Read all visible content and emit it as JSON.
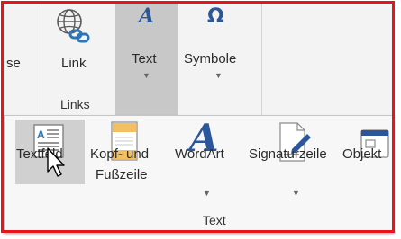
{
  "ribbon": {
    "partial_left_label": "se",
    "link_button": {
      "label": "Link",
      "icon": "globe-link-icon"
    },
    "text_button": {
      "label": "Text",
      "icon": "wordart-a-icon"
    },
    "symbole_button": {
      "label": "Symbole",
      "icon": "omega-icon"
    },
    "links_group_label": "Links"
  },
  "text_panel": {
    "items": [
      {
        "label": "Textfeld",
        "icon": "textbox-icon"
      },
      {
        "label_line1": "Kopf- und",
        "label_line2": "Fußzeile",
        "icon": "header-footer-icon"
      },
      {
        "label": "WordArt",
        "icon": "wordart-icon"
      },
      {
        "label": "Signaturzeile",
        "icon": "signature-line-icon"
      },
      {
        "label": "Objekt",
        "icon": "object-icon"
      }
    ],
    "group_label": "Text"
  },
  "colors": {
    "frame": "#e8131b",
    "accent_blue": "#2b579a",
    "highlight": "#c8c8c8"
  }
}
